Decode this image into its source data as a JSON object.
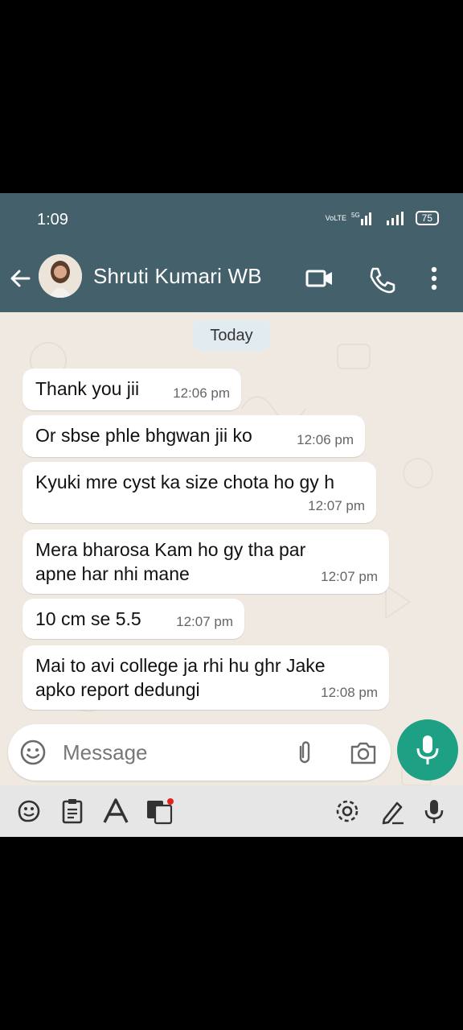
{
  "status": {
    "time": "1:09",
    "net1": "VoLTE",
    "net2": "5G",
    "battery": "75"
  },
  "header": {
    "contact_name": "Shruti Kumari WB"
  },
  "date_label": "Today",
  "messages": [
    {
      "text": "Thank you jii",
      "time": "12:06 pm"
    },
    {
      "text": "Or sbse phle bhgwan jii ko",
      "time": "12:06 pm"
    },
    {
      "text": "Kyuki mre cyst ka size chota ho gy h",
      "time": "12:07 pm"
    },
    {
      "line1": "Mera bharosa Kam ho gy tha par",
      "line2": "apne har nhi mane",
      "time": "12:07 pm"
    },
    {
      "text": "10 cm se 5.5",
      "time": "12:07 pm"
    },
    {
      "line1": "Mai to avi college ja rhi hu ghr Jake",
      "line2": "apko report dedungi",
      "time": "12:08 pm"
    }
  ],
  "composer": {
    "placeholder": "Message"
  },
  "icons": {
    "back": "arrow-left",
    "video": "video-camera",
    "call": "phone",
    "menu": "kebab-menu",
    "emoji": "smiley",
    "attach": "paperclip",
    "camera": "camera",
    "mic": "microphone",
    "kb": [
      "sticker",
      "clipboard",
      "font",
      "translate",
      "settings",
      "handwriting",
      "voice"
    ]
  },
  "colors": {
    "header": "#43606b",
    "fab": "#1ea085",
    "chat_bg": "#efe9e1"
  }
}
